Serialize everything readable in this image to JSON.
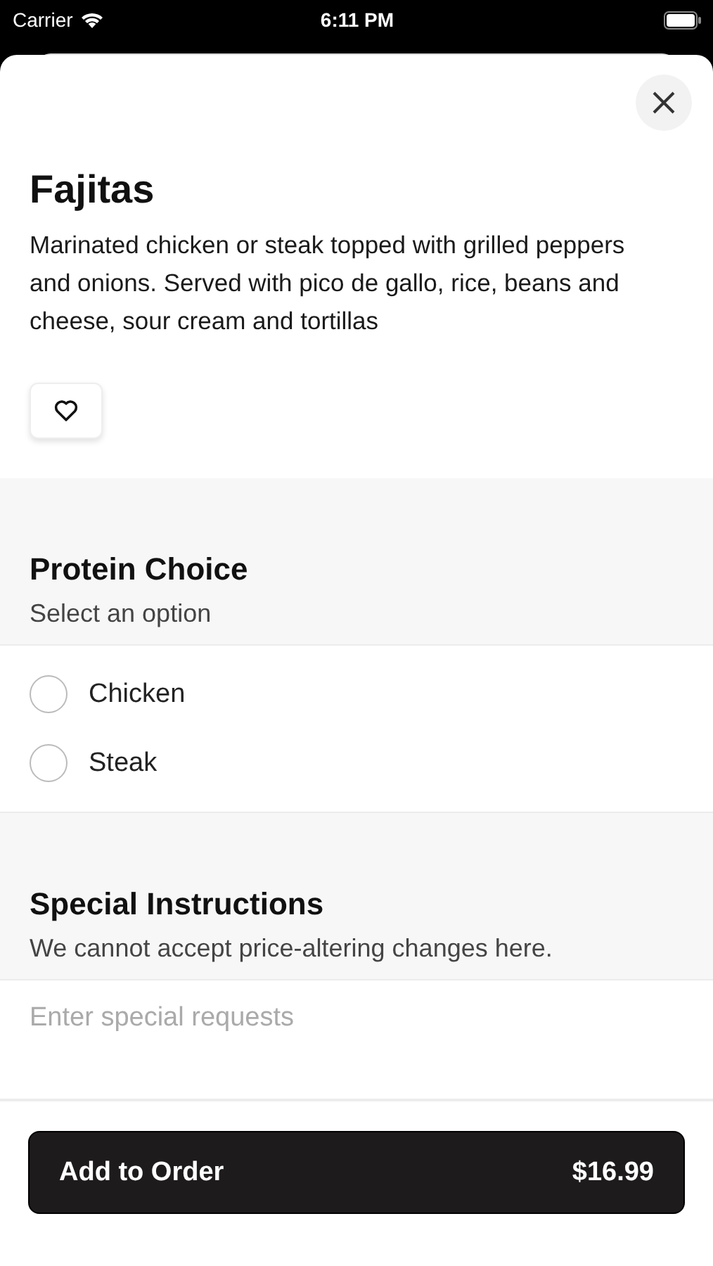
{
  "status_bar": {
    "carrier": "Carrier",
    "time": "6:11 PM"
  },
  "item": {
    "title": "Fajitas",
    "description": "Marinated chicken or steak topped with grilled peppers and onions. Served with pico de gallo, rice, beans and cheese, sour cream and tortillas"
  },
  "protein_choice": {
    "heading": "Protein Choice",
    "subtitle": "Select an option",
    "options": [
      {
        "label": "Chicken",
        "selected": false
      },
      {
        "label": "Steak",
        "selected": false
      }
    ]
  },
  "special_instructions": {
    "heading": "Special Instructions",
    "subtitle": "We cannot accept price-altering changes here.",
    "placeholder": "Enter special requests"
  },
  "add_button": {
    "label": "Add to Order",
    "price": "$16.99"
  }
}
